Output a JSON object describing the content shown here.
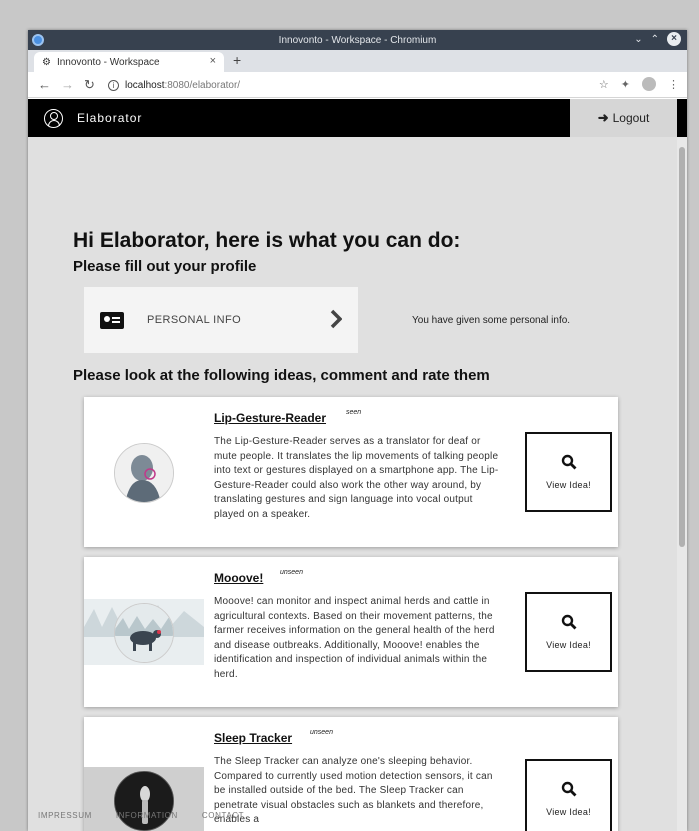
{
  "browser": {
    "window_title": "Innovonto - Workspace - Chromium",
    "tab_title": "Innovonto - Workspace",
    "url_host": "localhost",
    "url_path": ":8080/elaborator/"
  },
  "appbar": {
    "title": "Elaborator",
    "logout_label": "Logout"
  },
  "main": {
    "headline": "Hi Elaborator, here is what you can do:",
    "profile_heading": "Please fill out your profile",
    "profile_card_label": "PERSONAL INFO",
    "profile_status": "You have given some personal info.",
    "ideas_heading": "Please look at the following ideas, comment and rate them"
  },
  "ideas": [
    {
      "name": "Lip-Gesture-Reader",
      "status": "seen",
      "description": "The Lip-Gesture-Reader serves as a translator for deaf or mute people. It translates the lip movements of talking people into text or gestures displayed on a smartphone app. The Lip-Gesture-Reader could also work the other way around, by translating gestures and sign language into vocal output played on a speaker.",
      "button_label": "View Idea!"
    },
    {
      "name": "Mooove!",
      "status": "unseen",
      "description": "Mooove! can monitor and inspect animal herds and cattle in agricultural contexts. Based on their movement patterns, the farmer receives information on the general health of the herd and disease outbreaks. Additionally, Mooove! enables the identification and inspection of individual animals within the herd.",
      "button_label": "View Idea!"
    },
    {
      "name": "Sleep Tracker",
      "status": "unseen",
      "description": "The Sleep Tracker can analyze one's sleeping behavior. Compared to currently used motion detection sensors, it can be installed outside of the bed. The Sleep Tracker can penetrate visual obstacles such as blankets and therefore, enables a",
      "button_label": "View Idea!"
    }
  ],
  "footer": {
    "impressum": "IMPRESSUM",
    "information": "INFORMATION",
    "contact": "CONTACT"
  }
}
